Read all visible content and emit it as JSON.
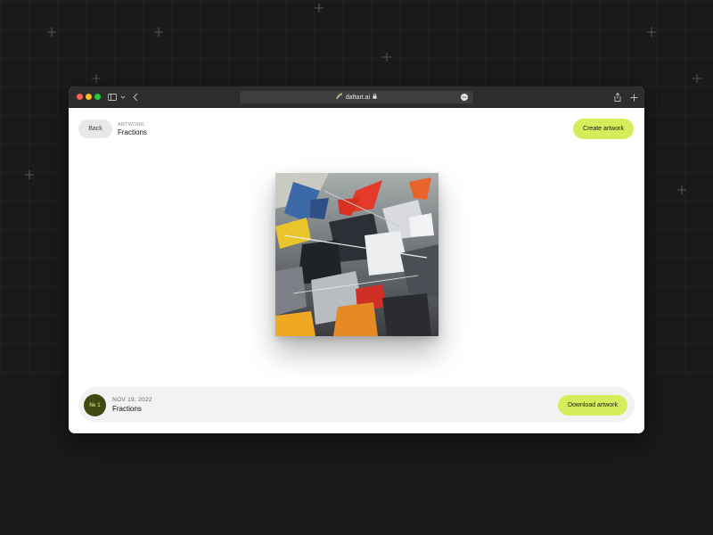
{
  "browser": {
    "url": "daftart.ai",
    "favicon": "rainbow-feather-icon",
    "lock_icon": "lock-icon"
  },
  "header": {
    "back_label": "Back",
    "crumb_label": "ARTWORK",
    "crumb_title": "Fractions",
    "create_label": "Create artwork"
  },
  "artwork": {
    "image": "abstract-painting"
  },
  "footer": {
    "number": "№ 1",
    "date": "NOV 19, 2022",
    "title": "Fractions",
    "download_label": "Download artwork"
  },
  "colors": {
    "accent": "#d7ec5b",
    "badge": "#3f4a12",
    "background": "#1a1a1a",
    "titlebar": "#2d2d2d"
  }
}
